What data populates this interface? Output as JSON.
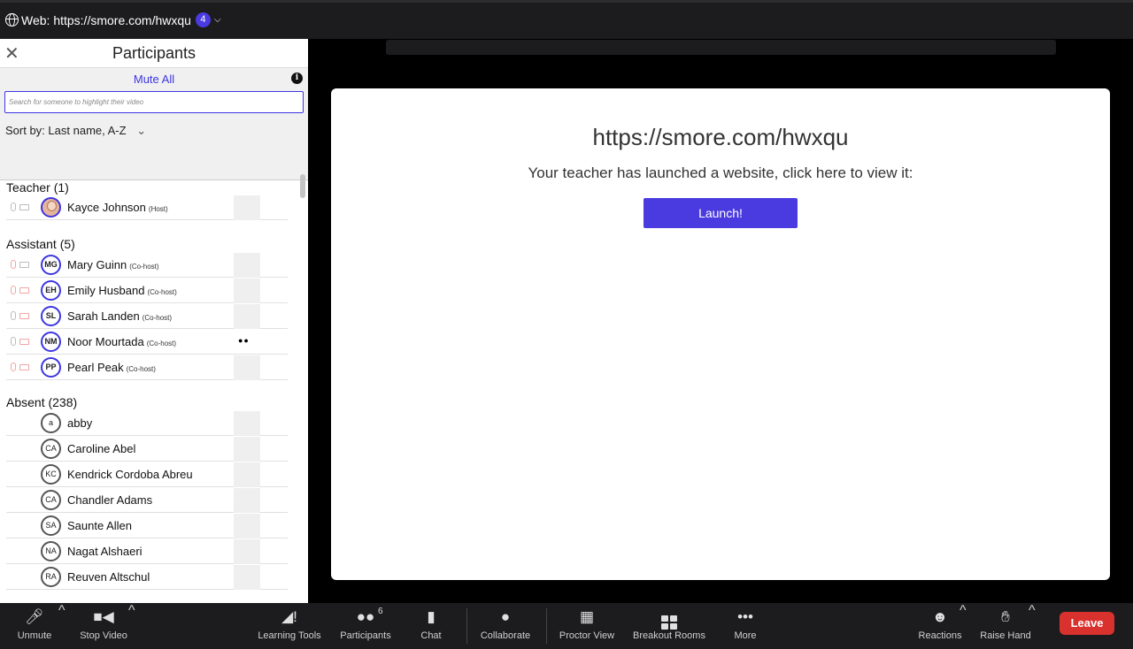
{
  "topbar": {
    "tab_label": "Web: https://smore.com/hwxqu",
    "tab_count": "4"
  },
  "panel": {
    "title": "Participants",
    "mute_all": "Mute All",
    "search_placeholder": "Search for someone to highlight their video",
    "sort_label": "Sort by:",
    "sort_value": "Last name, A-Z",
    "groups": {
      "teacher": {
        "label": "Teacher (1)",
        "members": [
          {
            "name": "Kayce Johnson",
            "role": "(Host)",
            "initials": ""
          }
        ]
      },
      "assistant": {
        "label": "Assistant  (5)",
        "members": [
          {
            "name": "Mary Guinn",
            "role": "(Co-host)",
            "initials": "MG"
          },
          {
            "name": "Emily Husband",
            "role": "(Co-host)",
            "initials": "EH"
          },
          {
            "name": "Sarah Landen",
            "role": "(Co-host)",
            "initials": "SL"
          },
          {
            "name": "Noor Mourtada",
            "role": "(Co-host)",
            "initials": "NM"
          },
          {
            "name": "Pearl Peak",
            "role": "(Co-host)",
            "initials": "PP"
          }
        ]
      },
      "absent": {
        "label": "Absent  (238)",
        "members": [
          {
            "name": "abby",
            "initials": "a"
          },
          {
            "name": "Caroline Abel",
            "initials": "CA"
          },
          {
            "name": "Kendrick Cordoba Abreu",
            "initials": "KC"
          },
          {
            "name": "Chandler Adams",
            "initials": "CA"
          },
          {
            "name": "Saunte Allen",
            "initials": "SA"
          },
          {
            "name": "Nagat Alshaeri",
            "initials": "NA"
          },
          {
            "name": "Reuven Altschul",
            "initials": "RA"
          }
        ]
      }
    }
  },
  "stage": {
    "url": "https://smore.com/hwxqu",
    "message": "Your teacher has launched a website, click here to view it:",
    "launch_label": "Launch!"
  },
  "toolbar": {
    "unmute": "Unmute",
    "stop_video": "Stop Video",
    "learning_tools": "Learning Tools",
    "participants": "Participants",
    "participants_count": "6",
    "chat": "Chat",
    "collaborate": "Collaborate",
    "proctor_view": "Proctor View",
    "breakout_rooms": "Breakout Rooms",
    "more": "More",
    "reactions": "Reactions",
    "raise_hand": "Raise Hand",
    "leave": "Leave"
  },
  "colors": {
    "accent": "#4a3be0",
    "leave": "#d9322e",
    "toolbar_bg": "#1c1c1e"
  }
}
